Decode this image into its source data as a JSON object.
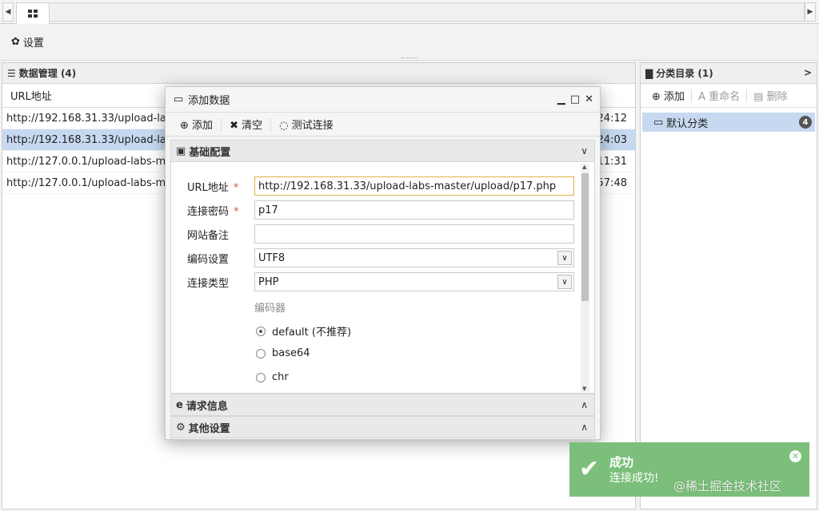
{
  "toolbar": {
    "settings_label": "设置"
  },
  "data_panel": {
    "title": "数据管理 (4)",
    "column_url": "URL地址",
    "rows": [
      {
        "url": "http://192.168.31.33/upload-labs-",
        "time": "24:12"
      },
      {
        "url": "http://192.168.31.33/upload-labs-",
        "time": "24:03"
      },
      {
        "url": "http://127.0.0.1/upload-labs-maste",
        "time": "11:31"
      },
      {
        "url": "http://127.0.0.1/upload-labs-maste",
        "time": "57:48"
      }
    ]
  },
  "category_panel": {
    "title": "分类目录 (1)",
    "add_label": "添加",
    "rename_label": "重命名",
    "delete_label": "删除",
    "items": [
      {
        "name": "默认分类",
        "count": "4"
      }
    ]
  },
  "dialog": {
    "title": "添加数据",
    "add_label": "添加",
    "clear_label": "清空",
    "test_label": "测试连接",
    "section_basic": "基础配置",
    "section_request": "请求信息",
    "section_other": "其他设置",
    "fields": {
      "url_label": "URL地址",
      "url_value": "http://192.168.31.33/upload-labs-master/upload/p17.php",
      "password_label": "连接密码",
      "password_value": "p17",
      "note_label": "网站备注",
      "note_value": "",
      "encoding_label": "编码设置",
      "encoding_value": "UTF8",
      "type_label": "连接类型",
      "type_value": "PHP",
      "required_mark": "*"
    },
    "encoder_title": "编码器",
    "encoders": [
      "default (不推荐)",
      "base64",
      "chr"
    ]
  },
  "toast": {
    "title": "成功",
    "message": "连接成功!",
    "color": "#7bbf7b"
  },
  "watermark": "@稀土掘金技术社区"
}
